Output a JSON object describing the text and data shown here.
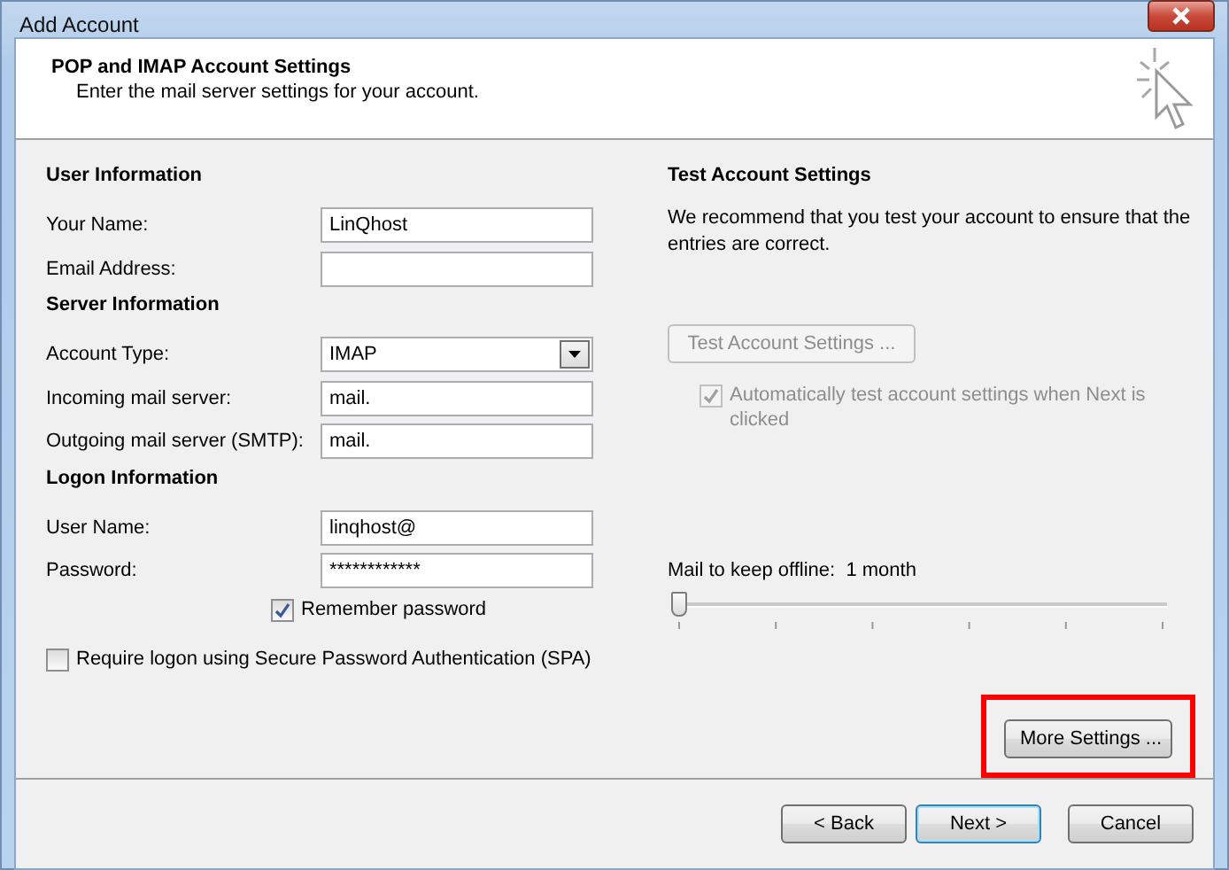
{
  "window": {
    "title": "Add Account"
  },
  "header": {
    "title": "POP and IMAP Account Settings",
    "subtitle": "Enter the mail server settings for your account."
  },
  "sections": [
    {
      "heading": "User Information",
      "fields": [
        {
          "label": "Your Name:",
          "kind": "text",
          "value": "LinQhost"
        },
        {
          "label": "Email Address:",
          "kind": "text"
        }
      ]
    },
    {
      "heading": "Server Information",
      "fields": [
        {
          "label": "Account Type:",
          "kind": "dropdown",
          "value": "IMAP"
        },
        {
          "label": "Incoming mail server:",
          "kind": "text",
          "value": "mail."
        },
        {
          "label": "Outgoing mail server (SMTP):",
          "kind": "text",
          "value": "mail."
        }
      ]
    },
    {
      "heading": "Logon Information",
      "fields": [
        {
          "label": "User Name:",
          "kind": "text",
          "value": "linqhost@"
        },
        {
          "label": "Password:",
          "kind": "text",
          "value": "************"
        }
      ]
    }
  ],
  "remember_password": {
    "label": "Remember password",
    "checked": true
  },
  "spa": {
    "label": "Require logon using Secure Password Authentication (SPA)",
    "checked": false
  },
  "test": {
    "heading": "Test Account Settings",
    "description": "We recommend that you test your account to ensure that the entries are correct.",
    "button": {
      "label": "Test Account Settings ...",
      "disabled": true
    },
    "auto_test": {
      "label": "Automatically test account settings when Next is clicked",
      "checked": true,
      "disabled": true
    }
  },
  "offline": {
    "label": "Mail to keep offline:",
    "value": "1 month",
    "level": 0
  },
  "more_settings": {
    "label": "More Settings ...",
    "highlighted": true
  },
  "footer_buttons": [
    {
      "label": "< Back",
      "default": false
    },
    {
      "label": "Next >",
      "default": true
    },
    {
      "label": "Cancel",
      "default": false
    }
  ]
}
